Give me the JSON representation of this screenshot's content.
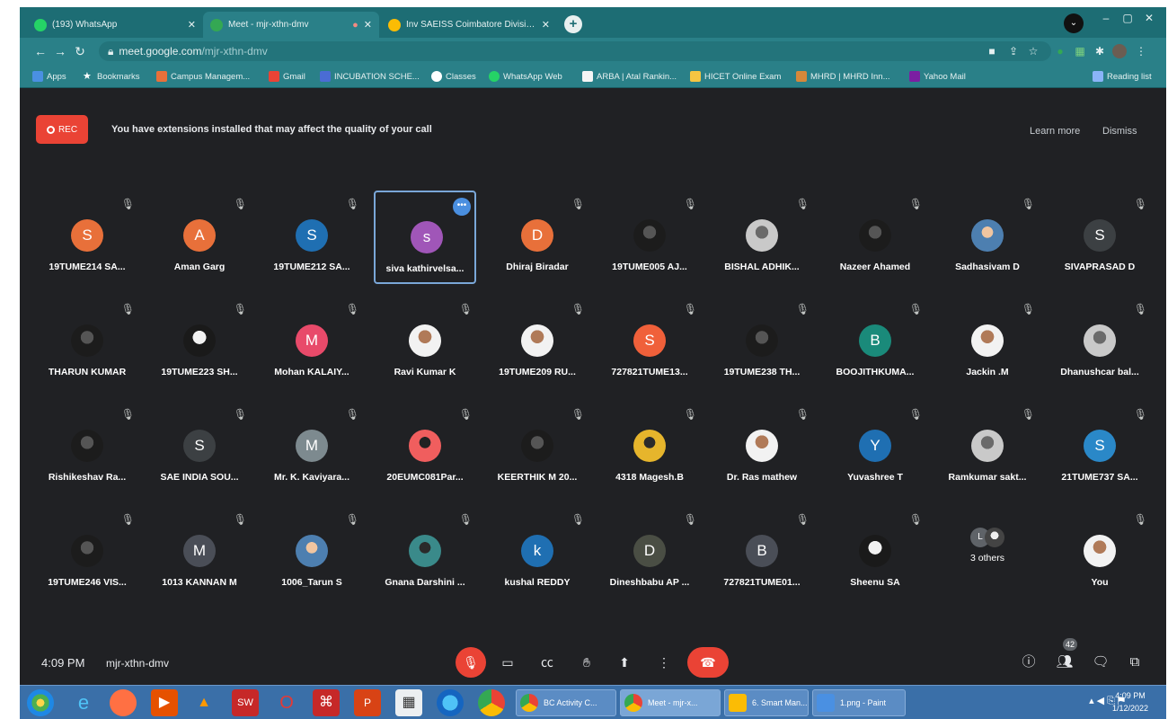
{
  "browser": {
    "tabs": [
      {
        "title": "(193) WhatsApp",
        "icon": "whatsapp-icon",
        "color": "#25d366"
      },
      {
        "title": "Meet - mjr-xthn-dmv",
        "icon": "meet-icon",
        "color": "#34a853"
      },
      {
        "title": "Inv SAEISS Coimbatore Divisio...",
        "icon": "drive-icon",
        "color": "#fbbc04"
      }
    ],
    "url_domain": "meet.google.com",
    "url_path": "/mjr-xthn-dmv",
    "bookmarks": [
      "Apps",
      "Bookmarks",
      "Campus Managem...",
      "Gmail",
      "INCUBATION SCHE...",
      "Classes",
      "WhatsApp Web",
      "ARBA | Atal Rankin...",
      "HICET Online Exam",
      "MHRD | MHRD Inn...",
      "Yahoo Mail",
      "Reading list"
    ]
  },
  "meet": {
    "rec_label": "REC",
    "warning": "You have extensions installed that may affect the quality of your call",
    "learn_more": "Learn more",
    "dismiss": "Dismiss",
    "time": "4:09 PM",
    "meeting_code": "mjr-xthn-dmv",
    "people_count": "42",
    "participants": [
      {
        "name": "19TUME214 SA...",
        "initial": "S",
        "color": "#e8703a"
      },
      {
        "name": "Aman Garg",
        "initial": "A",
        "color": "#e8703a"
      },
      {
        "name": "19TUME212 SA...",
        "initial": "S",
        "color": "#1f6fb2"
      },
      {
        "name": "siva kathirvelsa...",
        "initial": "s",
        "color": "#a056b8"
      },
      {
        "name": "Dhiraj Biradar",
        "initial": "D",
        "color": "#e8703a"
      },
      {
        "name": "19TUME005 AJ...",
        "photo": "dark"
      },
      {
        "name": "BISHAL ADHIK...",
        "photo": "gray"
      },
      {
        "name": "Nazeer Ahamed",
        "photo": "dark"
      },
      {
        "name": "Sadhasivam D",
        "photo": "blue"
      },
      {
        "name": "SIVAPRASAD D",
        "initial": "S",
        "color": "#3c4043"
      },
      {
        "name": "THARUN KUMAR",
        "photo": "dark"
      },
      {
        "name": "19TUME223 SH...",
        "photo": "bw"
      },
      {
        "name": "Mohan KALAIY...",
        "initial": "M",
        "color": "#e84a6a"
      },
      {
        "name": "Ravi Kumar K",
        "photo": "warm"
      },
      {
        "name": "19TUME209 RU...",
        "photo": "warm"
      },
      {
        "name": "727821TUME13...",
        "initial": "S",
        "color": "#f0603a"
      },
      {
        "name": "19TUME238 TH...",
        "photo": "dark"
      },
      {
        "name": "BOOJITHKUMA...",
        "initial": "B",
        "color": "#1a8a7a"
      },
      {
        "name": "Jackin .M",
        "photo": "warm"
      },
      {
        "name": "Dhanushcar bal...",
        "photo": "gray"
      },
      {
        "name": "Rishikeshav Ra...",
        "photo": "dark"
      },
      {
        "name": "SAE INDIA SOU...",
        "initial": "S",
        "color": "#3c4043"
      },
      {
        "name": "Mr. K. Kaviyara...",
        "initial": "M",
        "color": "#7d8a8f"
      },
      {
        "name": "20EUMC081Par...",
        "photo": "red"
      },
      {
        "name": "KEERTHIK M 20...",
        "photo": "dark"
      },
      {
        "name": "4318 Magesh.B",
        "photo": "yellow"
      },
      {
        "name": "Dr. Ras mathew",
        "photo": "warm"
      },
      {
        "name": "Yuvashree T",
        "initial": "Y",
        "color": "#1f6fb2"
      },
      {
        "name": "Ramkumar sakt...",
        "photo": "gray"
      },
      {
        "name": "21TUME737 SA...",
        "initial": "S",
        "color": "#2a88c8"
      },
      {
        "name": "19TUME246 VIS...",
        "photo": "dark"
      },
      {
        "name": "1013 KANNAN M",
        "initial": "M",
        "color": "#4a4e57"
      },
      {
        "name": "1006_Tarun S",
        "photo": "blue"
      },
      {
        "name": "Gnana Darshini ...",
        "photo": "teal"
      },
      {
        "name": "kushal REDDY",
        "initial": "k",
        "color": "#1f6fb2"
      },
      {
        "name": "Dineshbabu AP ...",
        "initial": "D",
        "color": "#4a4e44"
      },
      {
        "name": "727821TUME01...",
        "initial": "B",
        "color": "#4a4e57"
      },
      {
        "name": "Sheenu SA",
        "photo": "bw"
      }
    ],
    "others": {
      "label": "3 others",
      "initial": "L"
    },
    "self": {
      "name": "You",
      "photo": "warm"
    },
    "active_speaker_index": 3,
    "controls": [
      "mic-off",
      "camera",
      "captions",
      "raise-hand",
      "present",
      "more",
      "end-call"
    ],
    "right_controls": [
      "info",
      "people",
      "chat",
      "activities"
    ]
  },
  "taskbar": {
    "tasks": [
      {
        "title": "BC Activity C...",
        "color": "#34a853"
      },
      {
        "title": "Meet - mjr-x...",
        "color": "#34a853"
      },
      {
        "title": "6. Smart Man...",
        "color": "#fbbc04"
      },
      {
        "title": "1.png - Paint",
        "color": "#4a90e2"
      }
    ],
    "time": "4:09 PM",
    "date": "1/12/2022"
  }
}
